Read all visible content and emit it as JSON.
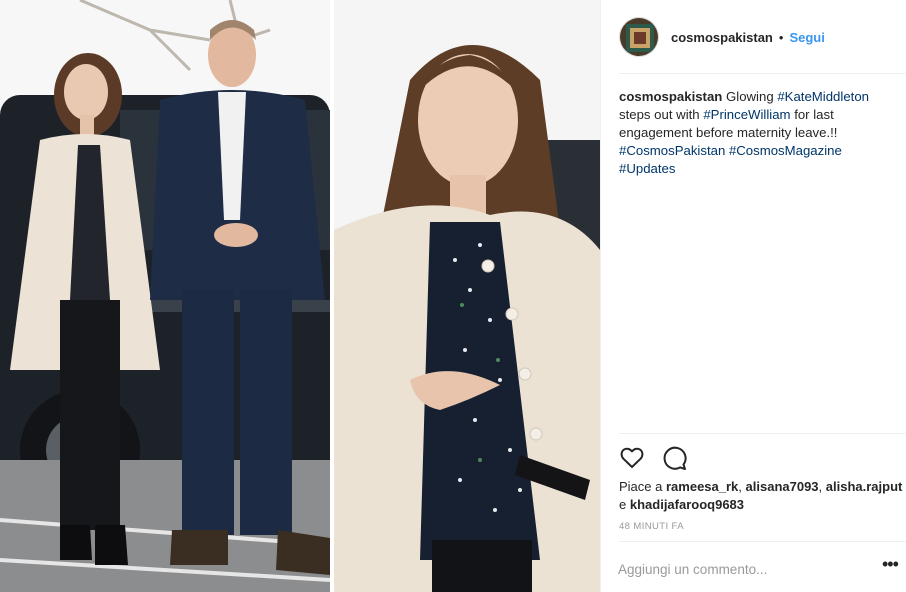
{
  "post": {
    "username": "cosmospakistan",
    "dot": "•",
    "follow_label": "Segui",
    "caption": {
      "username": "cosmospakistan",
      "text_1": "Glowing",
      "tag_1": "#KateMiddleton",
      "text_2": "steps out with",
      "tag_2": "#PrinceWilliam",
      "text_3": "for last engagement before maternity leave.!!",
      "tag_3": "#CosmosPakistan",
      "tag_4": "#CosmosMagazine",
      "tag_5": "#Updates"
    },
    "likes": {
      "prefix": "Piace a",
      "users": [
        "rameesa_rk",
        "alisana7093",
        "alisha.rajput"
      ],
      "conjunction": "e",
      "last_user": "khadijafarooq9683"
    },
    "time": "48 MINUTI FA",
    "comment_placeholder": "Aggiungi un commento...",
    "more_label": "•••"
  },
  "icons": {
    "like": "heart-outline",
    "comment": "speech-bubble-outline",
    "more": "ellipsis"
  },
  "colors": {
    "link_blue": "#3897f0",
    "hashtag": "#003569",
    "muted": "#999999",
    "text": "#262626"
  }
}
